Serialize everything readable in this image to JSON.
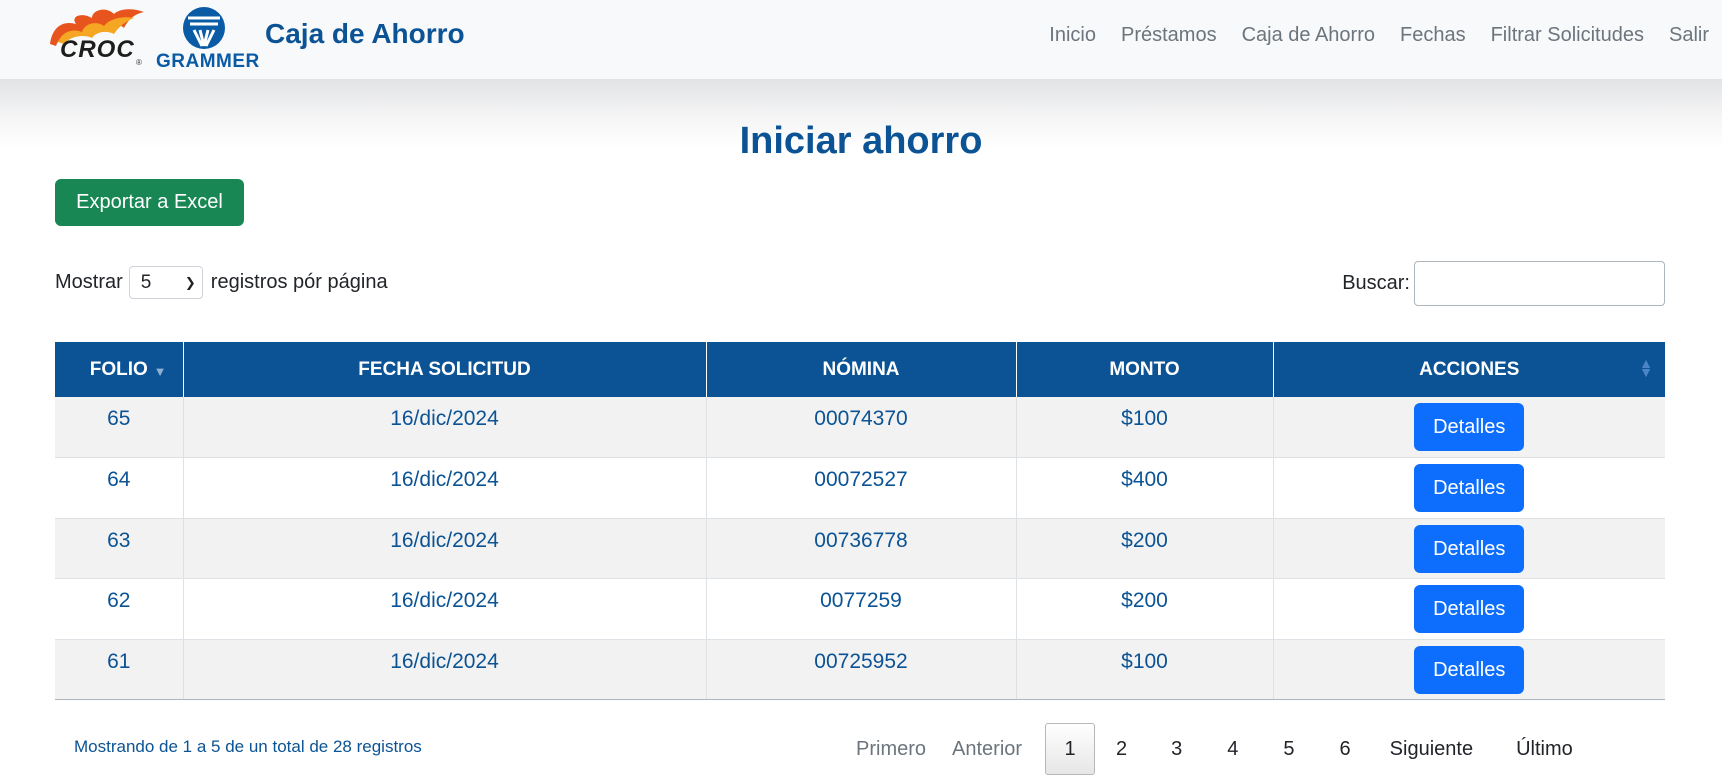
{
  "navbar": {
    "croc_text": "CROC",
    "croc_reg": "®",
    "grammer_text": "GRAMMER",
    "title": "Caja de Ahorro",
    "links": [
      "Inicio",
      "Préstamos",
      "Caja de Ahorro",
      "Fechas",
      "Filtrar Solicitudes",
      "Salir"
    ]
  },
  "page": {
    "title": "Iniciar ahorro",
    "export_button": "Exportar a Excel"
  },
  "length_control": {
    "prefix": "Mostrar",
    "selected": "5",
    "suffix": "registros pór página"
  },
  "search": {
    "label": "Buscar:",
    "value": ""
  },
  "table": {
    "columns": [
      "FOLIO",
      "FECHA SOLICITUD",
      "NÓMINA",
      "MONTO",
      "ACCIONES"
    ],
    "action_label": "Detalles",
    "rows": [
      {
        "folio": "65",
        "fecha": "16/dic/2024",
        "nomina": "00074370",
        "monto": "$100"
      },
      {
        "folio": "64",
        "fecha": "16/dic/2024",
        "nomina": "00072527",
        "monto": "$400"
      },
      {
        "folio": "63",
        "fecha": "16/dic/2024",
        "nomina": "00736778",
        "monto": "$200"
      },
      {
        "folio": "62",
        "fecha": "16/dic/2024",
        "nomina": "0077259",
        "monto": "$200"
      },
      {
        "folio": "61",
        "fecha": "16/dic/2024",
        "nomina": "00725952",
        "monto": "$100"
      }
    ]
  },
  "footer": {
    "info": "Mostrando de 1 a 5 de un total de 28 registros",
    "pagination": {
      "first": "Primero",
      "previous": "Anterior",
      "pages": [
        "1",
        "2",
        "3",
        "4",
        "5",
        "6"
      ],
      "current": "1",
      "next": "Siguiente",
      "last": "Último"
    }
  },
  "colors": {
    "brand_blue": "#0b5394",
    "excel_green": "#198754",
    "action_blue": "#0d6efd"
  }
}
